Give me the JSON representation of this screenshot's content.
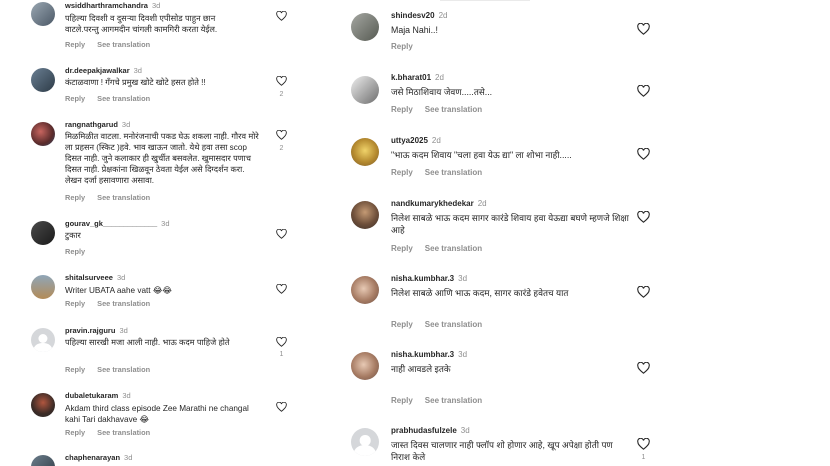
{
  "actions": {
    "reply": "Reply",
    "translate": "See translation"
  },
  "left": [
    {
      "user": "wsiddharthramchandra",
      "ago": "3d",
      "text": "पहिल्या दिवशी व दुसऱ्या दिवशी एपीसोड पाहुन छान वाटले.परन्तु आगमदीन चांगली कामगिरी करता येईल.",
      "likes": ""
    },
    {
      "user": "dr.deepakjawalkar",
      "ago": "3d",
      "text": "कंटाळवाणा ! गँगचे प्रमुख खोटे खोटे हसत होते !!",
      "likes": "2"
    },
    {
      "user": "rangnathgarud",
      "ago": "3d",
      "text": "मिळमिळीत वाटला. मनोरंजनाची पकड घेऊ शकला नाही. गौरव मोरे ला प्रहसन (स्किट )हवे. भाव खाऊन जातो. येथे हवा तसा scop दिसत नाही. जुने कलाकार ही खुर्चीत बसवलेत. खुमासदार पणाच दिसत नाही. प्रेक्षकांना खिळवून ठेवता येईल असे दिग्दर्शन करा. लेखन दर्जा हसावणारा असावा.",
      "likes": "2"
    },
    {
      "user": "gourav_gk_____________",
      "ago": "3d",
      "text": "टुकार",
      "likes": ""
    },
    {
      "user": "shitalsurveee",
      "ago": "3d",
      "text": "Writer UBATA aahe vatt 😂😂",
      "likes": ""
    },
    {
      "user": "pravin.rajguru",
      "ago": "3d",
      "text": "पहिल्या सारखी मजा आली नाही. भाऊ कदम पाहिजे होते",
      "likes": "1"
    },
    {
      "user": "dubaletukaram",
      "ago": "3d",
      "text": "Akdam third class episode Zee Marathi ne changal kahi Tari dakhavave 😂",
      "likes": ""
    },
    {
      "user": "chaphenarayan",
      "ago": "3d",
      "text": "",
      "likes": ""
    }
  ],
  "right": [
    {
      "user": "shindesv20",
      "ago": "2d",
      "text": "Maja Nahi..!",
      "likes": ""
    },
    {
      "user": "k.bharat01",
      "ago": "2d",
      "text": "जसे मिठाशिवाय जेवण.....तसे...",
      "likes": ""
    },
    {
      "user": "uttya2025",
      "ago": "2d",
      "text": "\"भाऊ कदम शिवाय \"चला हवा येऊ द्या\" ला शोभा नाही.....",
      "likes": ""
    },
    {
      "user": "nandkumarykhedekar",
      "ago": "2d",
      "text": "निलेश साबळे भाऊ कदम सागर कारंडे शिवाय हवा येऊद्या बघणे म्हणजे शिक्षा आहे",
      "likes": ""
    },
    {
      "user": "nisha.kumbhar.3",
      "ago": "3d",
      "text": "निलेश साबळे आणि भाऊ कदम, सागर कारंडे हवेतच यात",
      "likes": ""
    },
    {
      "user": "nisha.kumbhar.3",
      "ago": "3d",
      "text": "नाही आवडले इतके",
      "likes": ""
    },
    {
      "user": "prabhudasfulzele",
      "ago": "3d",
      "text": "जास्त दिवस चालणार नाही फ्लॉप शो होणार आहे, खूप अपेक्षा होती पण निराश केले",
      "likes": "1"
    }
  ]
}
